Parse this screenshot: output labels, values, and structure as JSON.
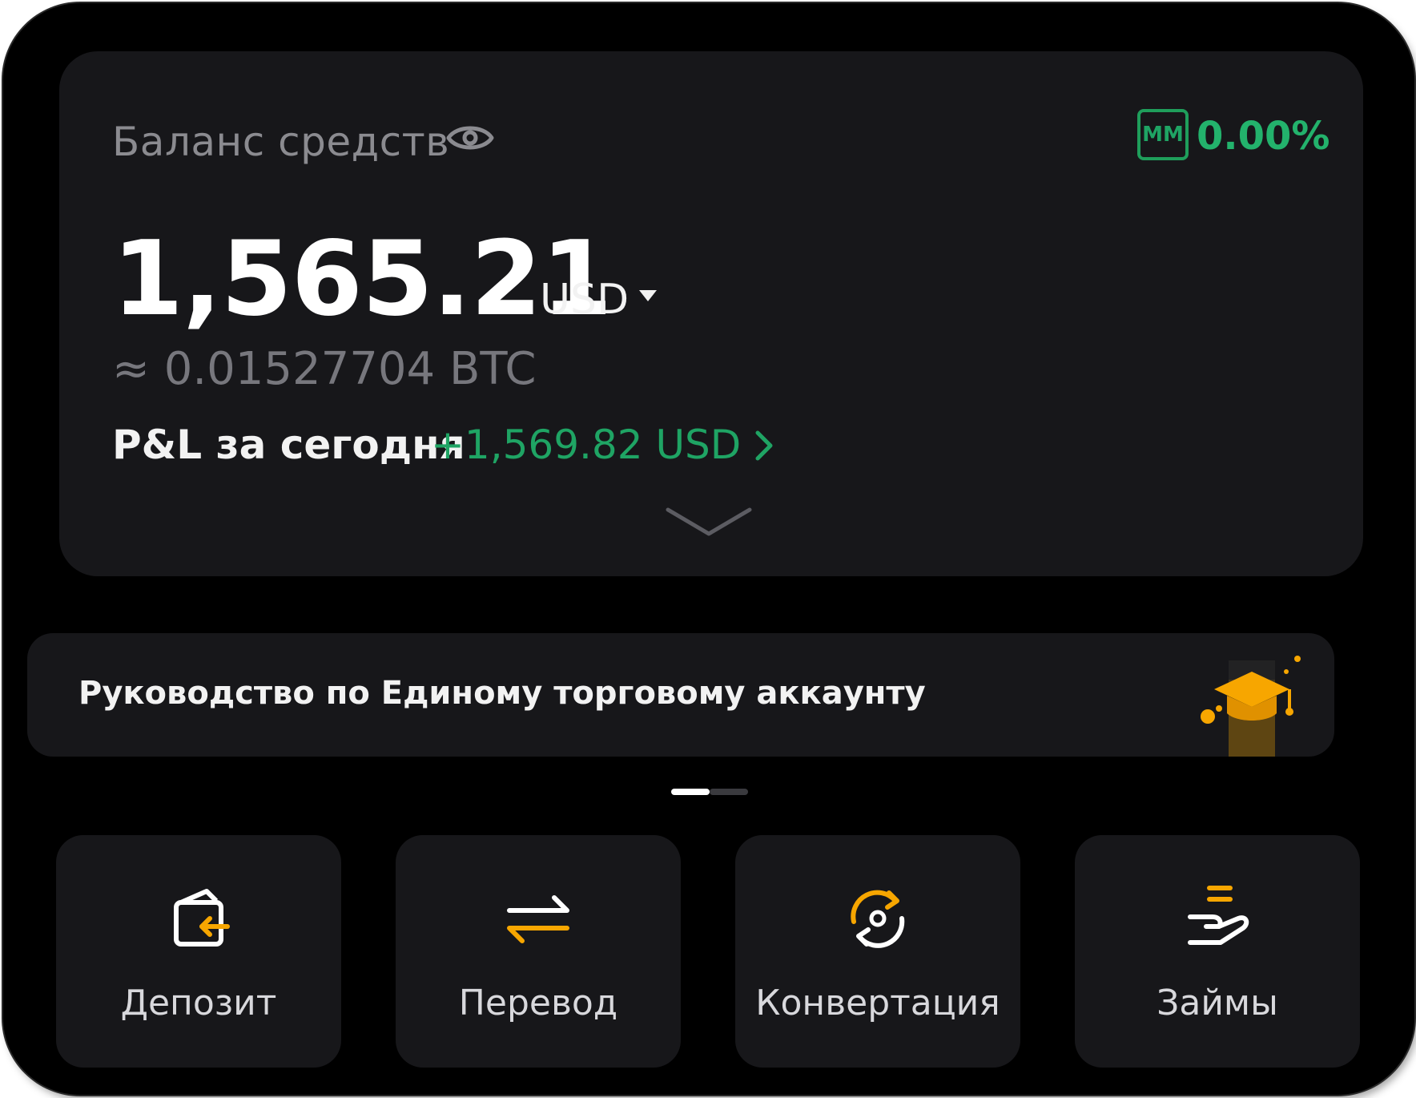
{
  "balance": {
    "label": "Баланс средств",
    "mm_badge": "MM",
    "mm_value": "0.00%",
    "amount": "1,565.21",
    "currency": "USD",
    "btc_equivalent": "≈ 0.01527704 BTC",
    "pnl_label": "P&L за сегодня",
    "pnl_value": "+1,569.82 USD"
  },
  "guide": {
    "text": "Руководство по Единому торговому аккаунту"
  },
  "pager": {
    "pages": 2,
    "active": 0
  },
  "actions": [
    {
      "label": "Депозит",
      "icon": "wallet-deposit-icon"
    },
    {
      "label": "Перевод",
      "icon": "transfer-arrows-icon"
    },
    {
      "label": "Конвертация",
      "icon": "convert-cycle-icon"
    },
    {
      "label": "Займы",
      "icon": "loan-hand-icon"
    }
  ],
  "colors": {
    "background": "#000000",
    "card": "#17171a",
    "positive": "#1fa464",
    "accent": "#f7a600",
    "text_primary": "#ffffff",
    "text_secondary": "#8b8b90"
  }
}
